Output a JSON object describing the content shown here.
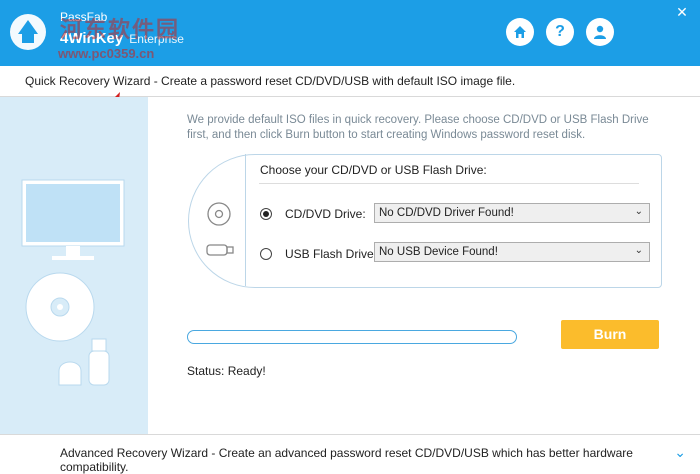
{
  "app": {
    "brand_top": "PassFab",
    "brand_main": "4WinKey",
    "brand_edition": "Enterprise",
    "watermark_cn": "河东软件园",
    "watermark_url": "www.pc0359.cn"
  },
  "toolbar": {
    "home_icon": "home-icon",
    "help_label": "?",
    "account_icon": "user-icon",
    "close_glyph": "✕"
  },
  "wizard": {
    "header": "Quick Recovery Wizard - Create a password reset CD/DVD/USB with default ISO image file.",
    "intro": "We provide default ISO files in quick recovery. Please choose CD/DVD or USB Flash Drive first, and then click Burn button to start creating Windows password reset disk.",
    "choose_label": "Choose your CD/DVD or USB Flash Drive:",
    "cd_label": "CD/DVD Drive:",
    "cd_value": "No CD/DVD Driver Found!",
    "usb_label": "USB Flash Drive:",
    "usb_value": "No USB Device Found!",
    "burn_label": "Burn",
    "status": "Status: Ready!",
    "progress": 0
  },
  "footer": {
    "text": "Advanced Recovery Wizard - Create an advanced password reset CD/DVD/USB which has better hardware compatibility.",
    "chevron": "⌄"
  },
  "colors": {
    "accent": "#1c9ee6",
    "burn": "#fbbc2c",
    "left_panel": "#d8ecf8"
  }
}
